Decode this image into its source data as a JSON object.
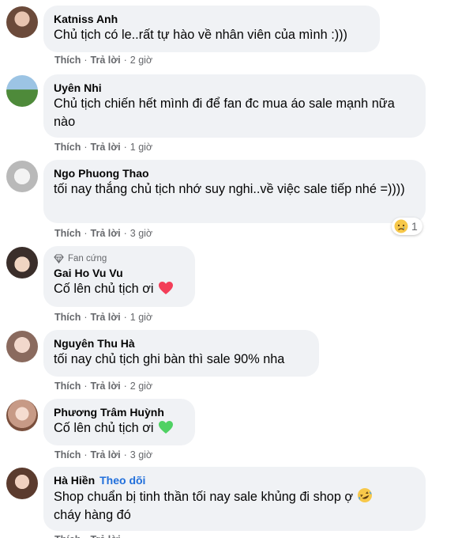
{
  "actions": {
    "like": "Thích",
    "reply": "Trả lời",
    "sep": "·"
  },
  "comments": [
    {
      "name": "Katniss Anh",
      "text": "Chủ tịch có le..rất tự hào về nhân viên của mình :)))",
      "time": "2 giờ"
    },
    {
      "name": "Uyên Nhi",
      "text": "Chủ tịch chiến hết mình đi để fan đc mua áo sale mạnh nữa nào",
      "time": "1 giờ"
    },
    {
      "name": "Ngo Phuong Thao",
      "text": "tối nay thắng chủ tịch nhớ suy nghi..về việc sale tiếp nhé =))))",
      "time": "3 giờ",
      "reaction_count": "1"
    },
    {
      "badge": "Fan cứng",
      "name": "Gai Ho Vu Vu",
      "text": "Cố lên chủ tịch ơi",
      "time": "1 giờ",
      "emoji": "red-heart"
    },
    {
      "name": "Nguyên Thu Hà",
      "text": "tối nay chủ tịch ghi bàn thì sale 90% nha",
      "time": "2 giờ"
    },
    {
      "name": "Phương Trâm Huỳnh",
      "text": "Cố lên chủ tịch ơi",
      "time": "3 giờ",
      "emoji": "green-heart"
    },
    {
      "name": "Hà Hiền",
      "follow": "Theo dõi",
      "text": "Shop chuẩn bị tinh thần tối nay sale khủng đi shop ợ",
      "text2": "cháy hàng đó",
      "time": ""
    }
  ],
  "colors": {
    "bubble": "#f0f2f5",
    "secondary": "#65676b",
    "follow": "#216fdb",
    "red_heart": "#f33e58",
    "green_heart": "#4fd163"
  }
}
